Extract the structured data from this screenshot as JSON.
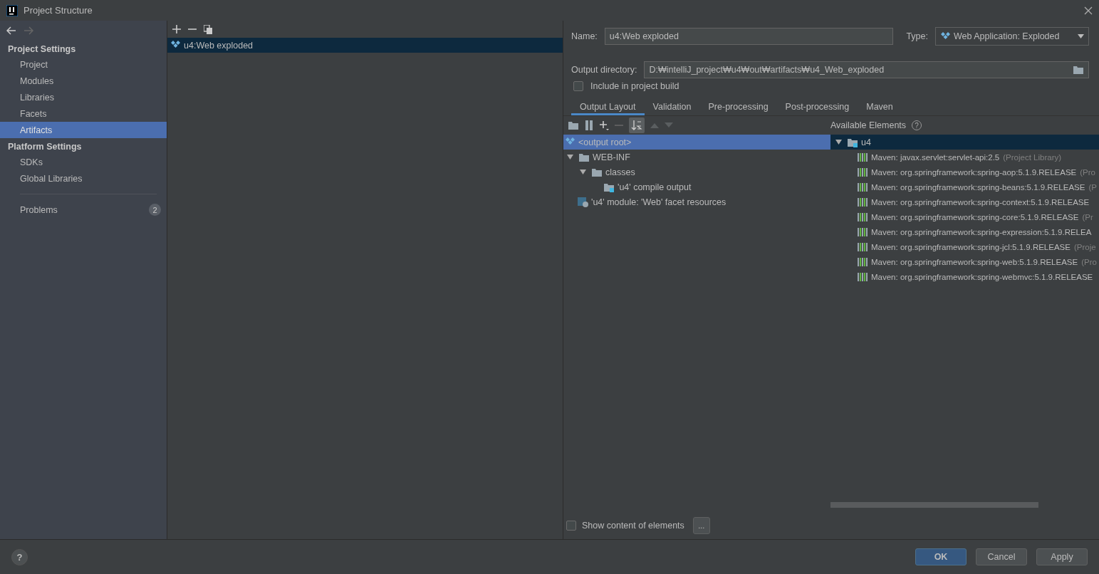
{
  "window": {
    "title": "Project Structure"
  },
  "sidebar": {
    "sections": [
      {
        "title": "Project Settings",
        "items": [
          {
            "label": "Project",
            "selected": false
          },
          {
            "label": "Modules",
            "selected": false
          },
          {
            "label": "Libraries",
            "selected": false
          },
          {
            "label": "Facets",
            "selected": false
          },
          {
            "label": "Artifacts",
            "selected": true
          }
        ]
      },
      {
        "title": "Platform Settings",
        "items": [
          {
            "label": "SDKs",
            "selected": false
          },
          {
            "label": "Global Libraries",
            "selected": false
          }
        ]
      }
    ],
    "problems": {
      "label": "Problems",
      "count": "2"
    }
  },
  "artifacts": [
    {
      "label": "u4:Web exploded",
      "selected": true
    }
  ],
  "form": {
    "name_label": "Name:",
    "name_value": "u4:Web exploded",
    "type_label": "Type:",
    "type_value": "Web Application: Exploded",
    "output_label": "Output directory:",
    "output_value": "D:₩intelliJ_project₩u4₩out₩artifacts₩u4_Web_exploded",
    "include_label": "Include in project build",
    "include_checked": false
  },
  "tabs": [
    {
      "label": "Output Layout",
      "selected": true
    },
    {
      "label": "Validation",
      "selected": false
    },
    {
      "label": "Pre-processing",
      "selected": false
    },
    {
      "label": "Post-processing",
      "selected": false
    },
    {
      "label": "Maven",
      "selected": false
    }
  ],
  "layout_tree": [
    {
      "kind": "root",
      "label": "<output root>",
      "selected": true
    },
    {
      "kind": "folder",
      "label": "WEB-INF",
      "selected": false,
      "expanded": true,
      "children": [
        {
          "kind": "folder",
          "label": "classes",
          "selected": false,
          "expanded": true,
          "children": [
            {
              "kind": "output",
              "label": "'u4' compile output",
              "selected": false
            }
          ]
        }
      ]
    },
    {
      "kind": "facet",
      "label": "'u4' module: 'Web' facet resources",
      "selected": false
    }
  ],
  "available": {
    "title": "Available Elements",
    "help": "?",
    "module": {
      "label": "u4",
      "expanded": true,
      "selected": true
    },
    "libraries": [
      {
        "label": "Maven: javax.servlet:servlet-api:2.5",
        "note": "(Project Library)"
      },
      {
        "label": "Maven: org.springframework:spring-aop:5.1.9.RELEASE",
        "note": "(Pro"
      },
      {
        "label": "Maven: org.springframework:spring-beans:5.1.9.RELEASE",
        "note": "(P"
      },
      {
        "label": "Maven: org.springframework:spring-context:5.1.9.RELEASE"
      },
      {
        "label": "Maven: org.springframework:spring-core:5.1.9.RELEASE",
        "note": "(Pr"
      },
      {
        "label": "Maven: org.springframework:spring-expression:5.1.9.RELEA"
      },
      {
        "label": "Maven: org.springframework:spring-jcl:5.1.9.RELEASE",
        "note": "(Proje"
      },
      {
        "label": "Maven: org.springframework:spring-web:5.1.9.RELEASE",
        "note": "(Pro"
      },
      {
        "label": "Maven: org.springframework:spring-webmvc:5.1.9.RELEASE"
      }
    ]
  },
  "show_content": {
    "label": "Show content of elements",
    "checked": false,
    "more": "..."
  },
  "footer": {
    "help": "?",
    "buttons": [
      {
        "label": "OK",
        "primary": true
      },
      {
        "label": "Cancel",
        "primary": false
      },
      {
        "label": "Apply",
        "primary": false
      }
    ]
  }
}
